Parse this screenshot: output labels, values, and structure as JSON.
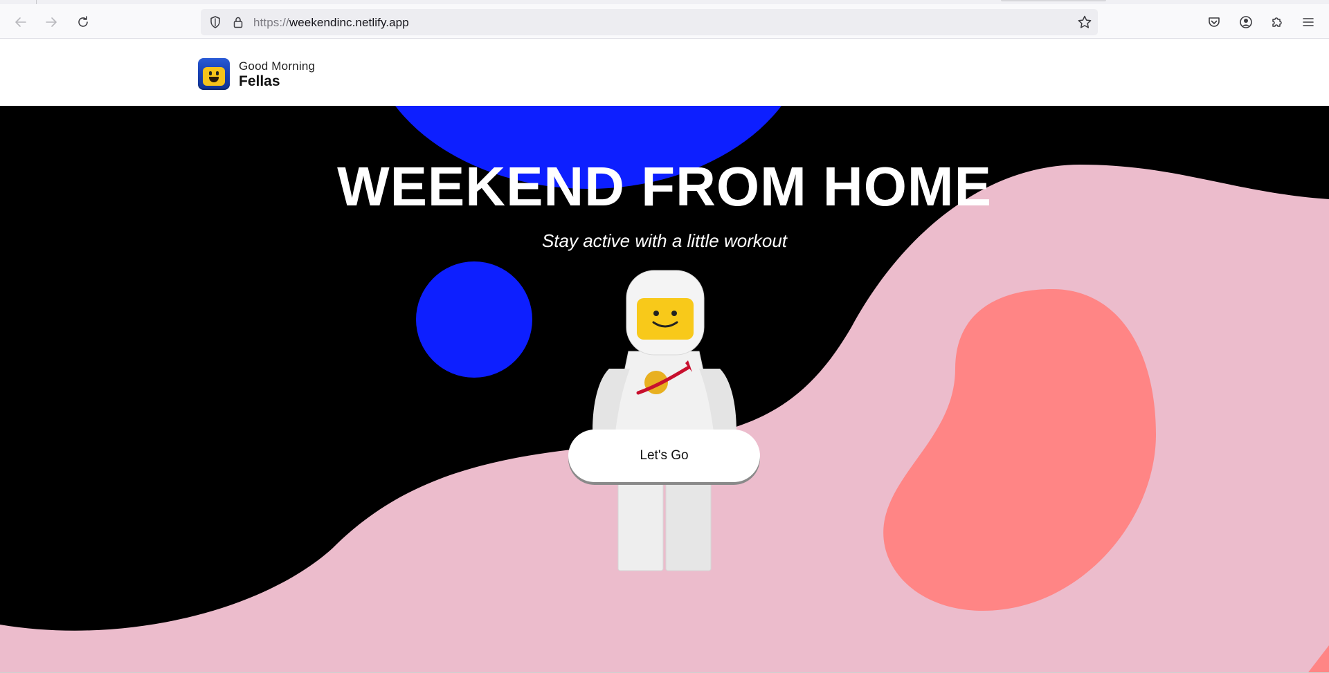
{
  "browser": {
    "url_scheme": "https://",
    "url_host": "weekendinc.netlify.app",
    "icons": {
      "back": "arrow-left-icon",
      "forward": "arrow-right-icon",
      "reload": "reload-icon",
      "shield": "shield-icon",
      "lock": "lock-icon",
      "bookmark": "star-icon",
      "pocket": "pocket-icon",
      "account": "account-icon",
      "extensions": "puzzle-icon",
      "menu": "hamburger-icon"
    }
  },
  "site": {
    "brand_top": "Good Morning",
    "brand_bottom": "Fellas",
    "logo_icon": "smiling-minifig-logo-icon"
  },
  "hero": {
    "headline": "WEEKEND FROM HOME",
    "subline": "Stay active with a little workout",
    "cta_label": "Let's Go",
    "figure": "astronaut-minifigure-image"
  },
  "colors": {
    "hero_background": "#000000",
    "blue_planet": "#0d1fff",
    "pink_wave": "#ecbccc",
    "coral_blob": "#ff8585",
    "text": "#ffffff"
  }
}
